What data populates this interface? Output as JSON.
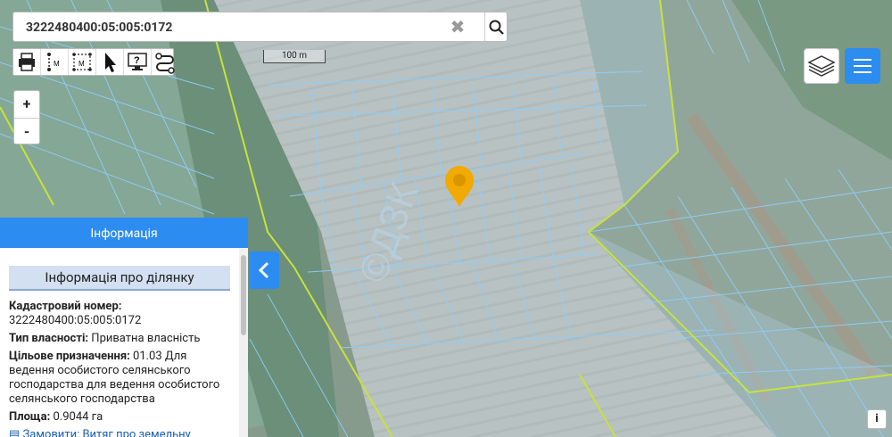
{
  "search": {
    "value": "3222480400:05:005:0172",
    "clear_symbol": "✖"
  },
  "scale": {
    "label": "100 m"
  },
  "zoom": {
    "in_label": "+",
    "out_label": "-"
  },
  "panel": {
    "header": "Інформація",
    "title": "Інформація про ділянку",
    "cadastral_label": "Кадастровий номер:",
    "cadastral_value": "3222480400:05:005:0172",
    "ownership_label": "Тип власності:",
    "ownership_value": "Приватна власність",
    "purpose_label": "Цільове призначення:",
    "purpose_value": "01.03 Для ведення особистого селянського господарства для ведення особистого селянського господарства",
    "area_label": "Площа:",
    "area_value": "0.9044 га",
    "extra_link": "Замовити: Витяг про земельну"
  },
  "info_button": "i",
  "map_overlay_text": "©ДЗК",
  "colors": {
    "accent": "#2d8cf0",
    "parcel_line": "#8ccfff",
    "boundary": "#c8e23a",
    "marker": "#f2a900"
  }
}
